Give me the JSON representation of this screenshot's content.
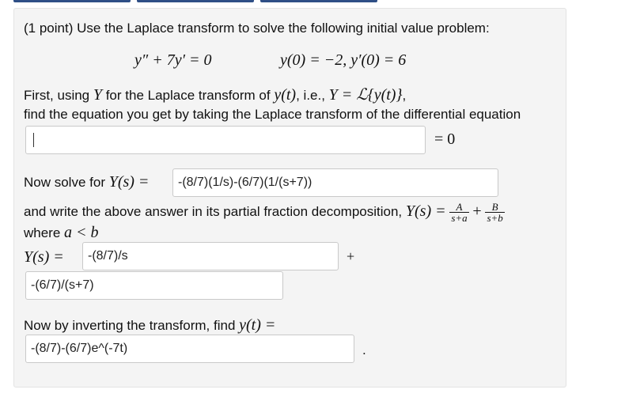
{
  "problem": {
    "intro": "(1 point) Use the Laplace transform to solve the following initial value problem:",
    "ode": "y″ + 7y′ = 0",
    "ic": "y(0) = −2,  y′(0) = 6"
  },
  "step1": {
    "line1_a": "First, using ",
    "line1_Y": "Y",
    "line1_b": " for the Laplace transform of ",
    "line1_y": "y(t)",
    "line1_c": ", i.e., ",
    "line1_def": "Y = ℒ{y(t)}",
    "line1_d": ",",
    "line2": "find the equation you get by taking the Laplace transform of the differential equation",
    "input_value": "",
    "rhs": "= 0"
  },
  "step2": {
    "label_a": "Now solve for ",
    "label_Ys": "Y(s) =",
    "input_value": "-(8/7)(1/s)-(6/7)(1/(s+7))"
  },
  "step3": {
    "text_a": "and write the above answer in its partial fraction decomposition, ",
    "text_Ys": "Y(s) =",
    "frac1_num": "A",
    "frac1_den": "s+a",
    "plus": "+",
    "frac2_num": "B",
    "frac2_den": "s+b",
    "where": "where ",
    "cond": "a < b",
    "label_Ys2": "Y(s) =",
    "input1_value": "-(8/7)/s",
    "plus2": "+",
    "input2_value": "-(6/7)/(s+7)"
  },
  "step4": {
    "label_a": "Now by inverting the transform, find ",
    "label_yt": "y(t) =",
    "input_value": "-(8/7)-(6/7)e^(-7t)",
    "period": "."
  }
}
